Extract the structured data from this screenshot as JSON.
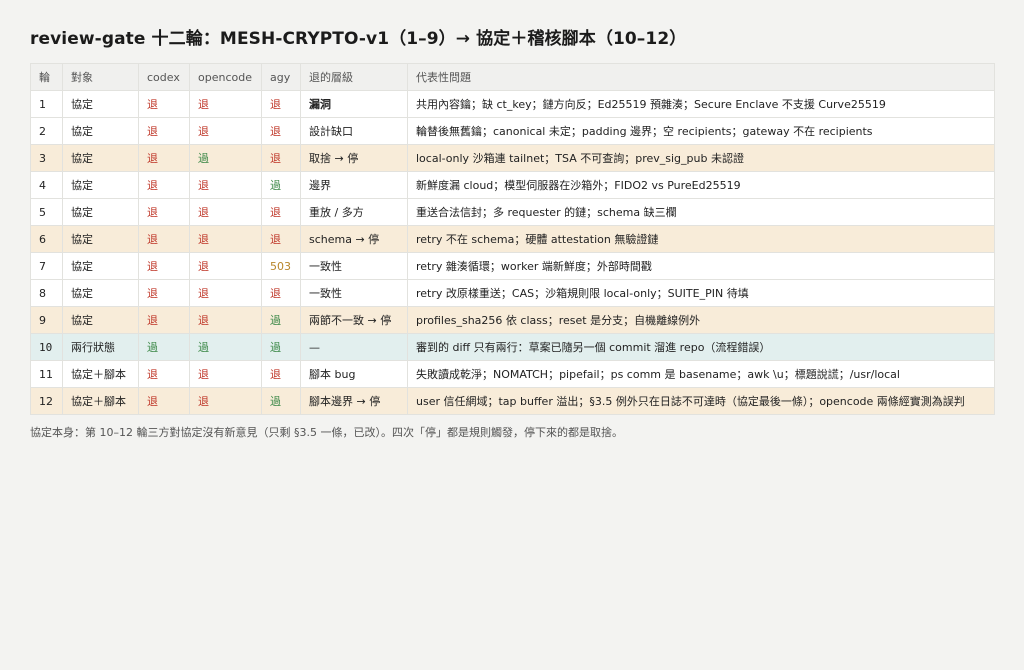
{
  "title": "review-gate 十二輪：MESH-CRYPTO-v1（1–9）→ 協定＋稽核腳本（10–12）",
  "colors": {
    "reject": "#c0392b",
    "pass": "#3f8a4a",
    "error": "#b8862b",
    "row_highlight": "#f8ecd9",
    "row_teal": "#e2efee"
  },
  "table": {
    "headers": [
      "輪",
      "對象",
      "codex",
      "opencode",
      "agy",
      "退的層級",
      "代表性問題"
    ],
    "rows": [
      {
        "round": "1",
        "object": "協定",
        "codex": "退",
        "opencode": "退",
        "agy": "退",
        "level": "漏洞",
        "issue": "共用內容鑰；缺 ct_key；鏈方向反；Ed25519 預雜湊；Secure Enclave 不支援 Curve25519"
      },
      {
        "round": "2",
        "object": "協定",
        "codex": "退",
        "opencode": "退",
        "agy": "退",
        "level": "設計缺口",
        "issue": "輪替後無舊鑰；canonical 未定；padding 邊界；空 recipients；gateway 不在 recipients"
      },
      {
        "round": "3",
        "object": "協定",
        "codex": "退",
        "opencode": "過",
        "agy": "退",
        "level": "取捨 → 停",
        "issue": "local-only 沙箱連 tailnet；TSA 不可查詢；prev_sig_pub 未認證"
      },
      {
        "round": "4",
        "object": "協定",
        "codex": "退",
        "opencode": "退",
        "agy": "過",
        "level": "邊界",
        "issue": "新鮮度漏 cloud；模型伺服器在沙箱外；FIDO2 vs PureEd25519"
      },
      {
        "round": "5",
        "object": "協定",
        "codex": "退",
        "opencode": "退",
        "agy": "退",
        "level": "重放 / 多方",
        "issue": "重送合法信封；多 requester 的鏈；schema 缺三欄"
      },
      {
        "round": "6",
        "object": "協定",
        "codex": "退",
        "opencode": "退",
        "agy": "退",
        "level": "schema → 停",
        "issue": "retry 不在 schema；硬體 attestation 無驗證鏈"
      },
      {
        "round": "7",
        "object": "協定",
        "codex": "退",
        "opencode": "退",
        "agy": "503",
        "level": "一致性",
        "issue": "retry 雜湊循環；worker 端新鮮度；外部時間戳"
      },
      {
        "round": "8",
        "object": "協定",
        "codex": "退",
        "opencode": "退",
        "agy": "退",
        "level": "一致性",
        "issue": "retry 改原樣重送；CAS；沙箱規則限 local-only；SUITE_PIN 待填"
      },
      {
        "round": "9",
        "object": "協定",
        "codex": "退",
        "opencode": "退",
        "agy": "過",
        "level": "兩節不一致 → 停",
        "issue": "profiles_sha256 依 class；reset 是分支；自機離線例外"
      },
      {
        "round": "10",
        "object": "兩行狀態",
        "codex": "過",
        "opencode": "過",
        "agy": "過",
        "level": "—",
        "issue": "審到的 diff 只有兩行：草案已隨另一個 commit 溜進 repo（流程錯誤）"
      },
      {
        "round": "11",
        "object": "協定＋腳本",
        "codex": "退",
        "opencode": "退",
        "agy": "退",
        "level": "腳本 bug",
        "issue": "失敗讀成乾淨；NOMATCH；pipefail；ps comm 是 basename；awk \\u；標題說謊；/usr/local"
      },
      {
        "round": "12",
        "object": "協定＋腳本",
        "codex": "退",
        "opencode": "退",
        "agy": "過",
        "level": "腳本邊界 → 停",
        "issue": "user 信任網域；tap buffer 溢出；§3.5 例外只在日誌不可達時（協定最後一條）；opencode 兩條經實測為誤判"
      }
    ]
  },
  "note": "協定本身：第 10–12 輪三方對協定沒有新意見（只剩 §3.5 一條，已改）。四次「停」都是規則觸發，停下來的都是取捨。"
}
